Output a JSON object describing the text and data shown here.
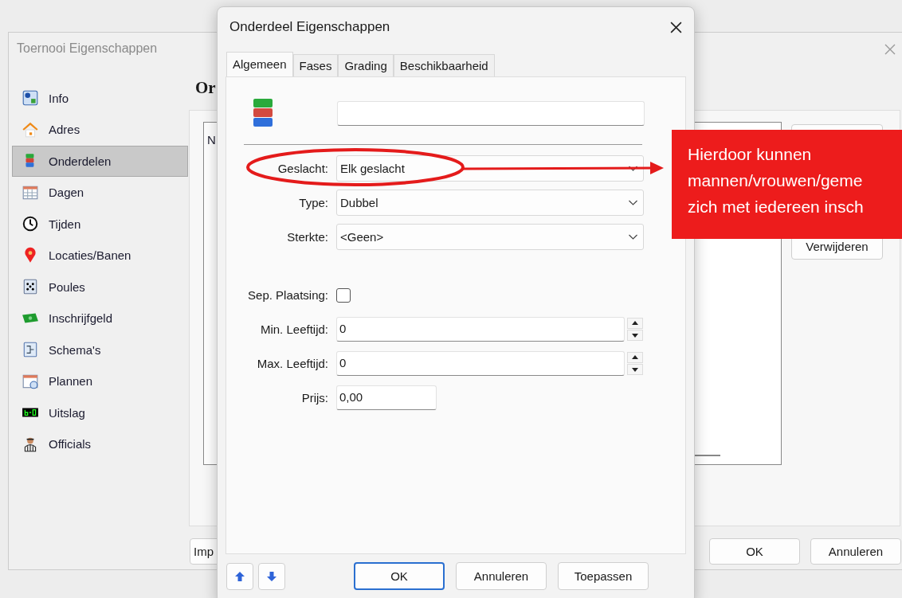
{
  "back_window": {
    "title": "Toernooi Eigenschappen",
    "heading": "Or",
    "sidebar": [
      {
        "label": "Info",
        "selected": false
      },
      {
        "label": "Adres",
        "selected": false
      },
      {
        "label": "Onderdelen",
        "selected": true
      },
      {
        "label": "Dagen",
        "selected": false
      },
      {
        "label": "Tijden",
        "selected": false
      },
      {
        "label": "Locaties/Banen",
        "selected": false
      },
      {
        "label": "Poules",
        "selected": false
      },
      {
        "label": "Inschrijfgeld",
        "selected": false
      },
      {
        "label": "Schema's",
        "selected": false
      },
      {
        "label": "Plannen",
        "selected": false
      },
      {
        "label": "Uitslag",
        "selected": false
      },
      {
        "label": "Officials",
        "selected": false
      }
    ],
    "list_header": "N",
    "side_button": "Verwijderen",
    "footer_left_button": "Imp",
    "footer_buttons": [
      "OK",
      "Annuleren"
    ]
  },
  "dialog": {
    "title": "Onderdeel Eigenschappen",
    "tabs": [
      {
        "label": "Algemeen",
        "selected": true
      },
      {
        "label": "Fases",
        "selected": false
      },
      {
        "label": "Grading",
        "selected": false
      },
      {
        "label": "Beschikbaarheid",
        "selected": false
      }
    ],
    "fields": [
      {
        "kind": "select",
        "label": "Geslacht:",
        "value": "Elk geslacht"
      },
      {
        "kind": "select",
        "label": "Type:",
        "value": "Dubbel"
      },
      {
        "kind": "select",
        "label": "Sterkte:",
        "value": "<Geen>"
      },
      {
        "kind": "checkbox",
        "label": "Sep. Plaatsing:",
        "checked": false
      },
      {
        "kind": "spin",
        "label": "Min. Leeftijd:",
        "value": "0"
      },
      {
        "kind": "spin",
        "label": "Max. Leeftijd:",
        "value": "0"
      },
      {
        "kind": "text",
        "label": "Prijs:",
        "value": "0,00"
      }
    ],
    "buttons": [
      {
        "label": "OK",
        "default": true
      },
      {
        "label": "Annuleren",
        "default": false
      },
      {
        "label": "Toepassen",
        "default": false
      }
    ]
  },
  "annotation": {
    "lines": [
      "Hierdoor kunnen",
      "mannen/vrouwen/geme",
      "zich met iedereen insch"
    ]
  }
}
